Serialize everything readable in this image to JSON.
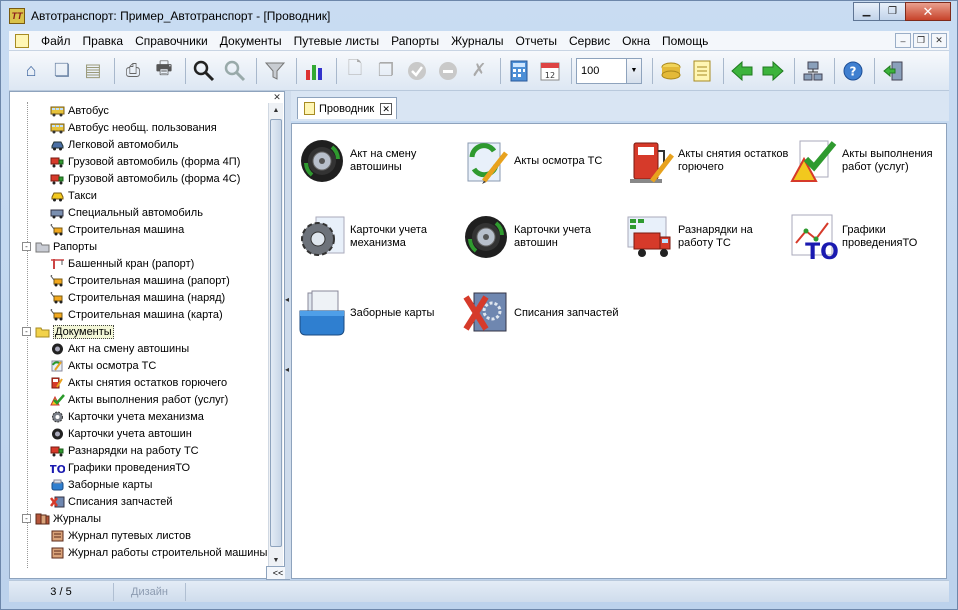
{
  "window": {
    "title": "Автотранспорт: Пример_Автотранспорт - [Проводник]",
    "app_icon_text": "TT"
  },
  "menubar": {
    "items": [
      "Файл",
      "Правка",
      "Справочники",
      "Документы",
      "Путевые листы",
      "Рапорты",
      "Журналы",
      "Отчеты",
      "Сервис",
      "Окна",
      "Помощь"
    ]
  },
  "toolbar": {
    "zoom_value": "100"
  },
  "tree": {
    "rows": [
      {
        "level": 1,
        "label": "Автобус",
        "icon": "bus-icon"
      },
      {
        "level": 1,
        "label": "Автобус необщ. пользования",
        "icon": "bus-icon"
      },
      {
        "level": 1,
        "label": "Легковой автомобиль",
        "icon": "car-icon"
      },
      {
        "level": 1,
        "label": "Грузовой автомобиль (форма 4П)",
        "icon": "truck-icon"
      },
      {
        "level": 1,
        "label": "Грузовой автомобиль (форма 4С)",
        "icon": "truck-icon"
      },
      {
        "level": 1,
        "label": "Такси",
        "icon": "taxi-icon"
      },
      {
        "level": 1,
        "label": "Специальный автомобиль",
        "icon": "special-car-icon"
      },
      {
        "level": 1,
        "label": "Строительная машина",
        "icon": "construction-machine-icon"
      },
      {
        "level": 0,
        "label": "Рапорты",
        "icon": "folder-icon",
        "expander": "-"
      },
      {
        "level": 1,
        "label": "Башенный кран (рапорт)",
        "icon": "crane-icon"
      },
      {
        "level": 1,
        "label": "Строительная машина (рапорт)",
        "icon": "construction-machine-icon"
      },
      {
        "level": 1,
        "label": "Строительная машина (наряд)",
        "icon": "construction-machine-icon"
      },
      {
        "level": 1,
        "label": "Строительная машина (карта)",
        "icon": "construction-machine-icon"
      },
      {
        "level": 0,
        "label": "Документы",
        "icon": "folder-open-icon",
        "expander": "-",
        "selected": true
      },
      {
        "level": 1,
        "label": "Акт на смену автошины",
        "icon": "tire-icon"
      },
      {
        "level": 1,
        "label": "Акты осмотра ТС",
        "icon": "inspection-icon"
      },
      {
        "level": 1,
        "label": "Акты снятия остатков горючего",
        "icon": "fuel-icon"
      },
      {
        "level": 1,
        "label": "Акты выполнения работ (услуг)",
        "icon": "checkmark-icon"
      },
      {
        "level": 1,
        "label": "Карточки учета механизма",
        "icon": "gear-icon"
      },
      {
        "level": 1,
        "label": "Карточки учета автошин",
        "icon": "tire-icon"
      },
      {
        "level": 1,
        "label": "Разнарядки на работу ТС",
        "icon": "truck-icon"
      },
      {
        "level": 1,
        "label": "Графики проведенияТО",
        "icon": "to-icon"
      },
      {
        "level": 1,
        "label": "Заборные карты",
        "icon": "box-icon"
      },
      {
        "level": 1,
        "label": "Списания запчастей",
        "icon": "parts-icon"
      },
      {
        "level": 0,
        "label": "Журналы",
        "icon": "journal-folder-icon",
        "expander": "-"
      },
      {
        "level": 1,
        "label": "Журнал путевых листов",
        "icon": "journal-icon"
      },
      {
        "level": 1,
        "label": "Журнал работы строительной машины",
        "icon": "journal-icon"
      }
    ]
  },
  "tab": {
    "label": "Проводник"
  },
  "explorer": {
    "items": [
      {
        "label": "Акт на смену автошины",
        "icon": "tire-icon"
      },
      {
        "label": "Акты осмотра ТС",
        "icon": "inspection-icon"
      },
      {
        "label": "Акты снятия остатков горючего",
        "icon": "fuel-icon"
      },
      {
        "label": "Акты выполнения работ (услуг)",
        "icon": "checkmark-icon"
      },
      {
        "label": "Карточки учета механизма",
        "icon": "gear-icon"
      },
      {
        "label": "Карточки учета автошин",
        "icon": "tire-icon"
      },
      {
        "label": "Разнарядки на работу ТС",
        "icon": "truck-icon"
      },
      {
        "label": "Графики проведенияТО",
        "icon": "to-icon"
      },
      {
        "label": "Заборные карты",
        "icon": "box-icon"
      },
      {
        "label": "Списания запчастей",
        "icon": "parts-icon"
      }
    ]
  },
  "statusbar": {
    "page": "3 / 5",
    "mode": "Дизайн"
  }
}
